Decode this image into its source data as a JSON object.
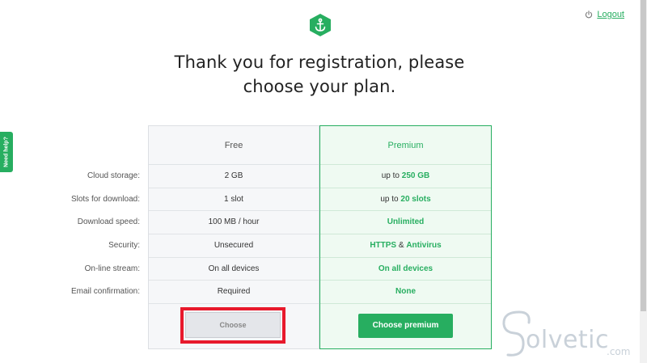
{
  "header": {
    "logo_icon": "anchor-icon",
    "logout_icon": "power-icon",
    "logout_label": "Logout"
  },
  "title_line1": "Thank you for registration, please",
  "title_line2": "choose your plan.",
  "help_tab": "Need help?",
  "features": [
    "Cloud storage:",
    "Slots for download:",
    "Download speed:",
    "Security:",
    "On-line stream:",
    "Email confirmation:"
  ],
  "plans": {
    "free": {
      "name": "Free",
      "values": [
        "2 GB",
        "1 slot",
        "100 MB / hour",
        "Unsecured",
        "On all devices",
        "Required"
      ],
      "button": "Choose"
    },
    "premium": {
      "name": "Premium",
      "storage_prefix": "up to ",
      "storage_value": "250 GB",
      "slots_prefix": "up to ",
      "slots_value": "20 slots",
      "speed": "Unlimited",
      "security_a": "HTTPS",
      "security_amp": " & ",
      "security_b": "Antivirus",
      "stream": "On all devices",
      "email": "None",
      "button": "Choose premium"
    }
  },
  "watermark": {
    "text": "olvetic",
    "suffix": ".com"
  },
  "colors": {
    "accent": "#27ae60",
    "highlight_border": "#e8192c"
  }
}
